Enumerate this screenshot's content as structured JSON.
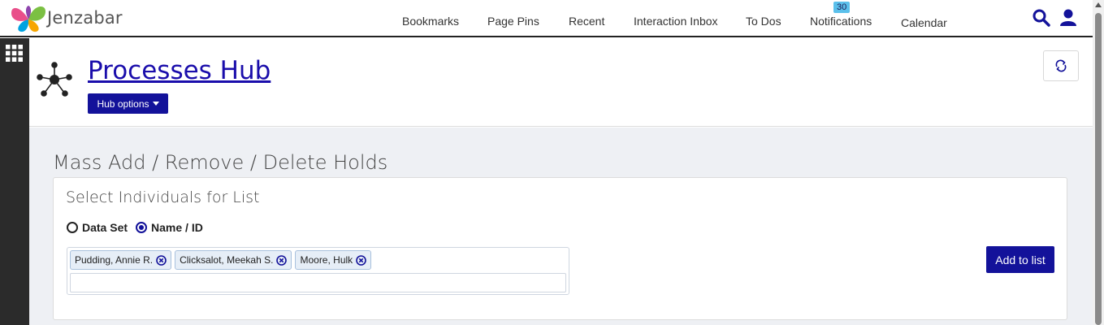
{
  "brand": {
    "name": "Jenzabar"
  },
  "nav": {
    "bookmarks": "Bookmarks",
    "page_pins": "Page Pins",
    "recent": "Recent",
    "interaction_inbox": "Interaction Inbox",
    "todos": "To Dos",
    "notifications": "Notifications",
    "notifications_count": "30",
    "calendar": "Calendar"
  },
  "icons": {
    "search": "search-icon",
    "user": "user-icon",
    "apps": "apps-grid-icon",
    "hub": "hub-network-icon",
    "refresh": "refresh-icon",
    "remove": "remove-circle-icon"
  },
  "hub": {
    "title": "Processes Hub",
    "options_label": "Hub options"
  },
  "main": {
    "section_title": "Mass Add / Remove / Delete Holds",
    "card": {
      "title": "Select Individuals for List",
      "radio_options": [
        {
          "label": "Data Set",
          "checked": false
        },
        {
          "label": "Name / ID",
          "checked": true
        }
      ],
      "tokens": [
        {
          "label": "Pudding, Annie R."
        },
        {
          "label": "Clicksalot, Meekah S."
        },
        {
          "label": "Moore, Hulk"
        }
      ],
      "input_value": "",
      "add_button": "Add to list"
    }
  },
  "colors": {
    "primary": "#13129a",
    "link": "#1a0dab",
    "badge": "#5bc0eb",
    "rail": "#2b2b2b",
    "content_bg": "#eef0f4"
  }
}
